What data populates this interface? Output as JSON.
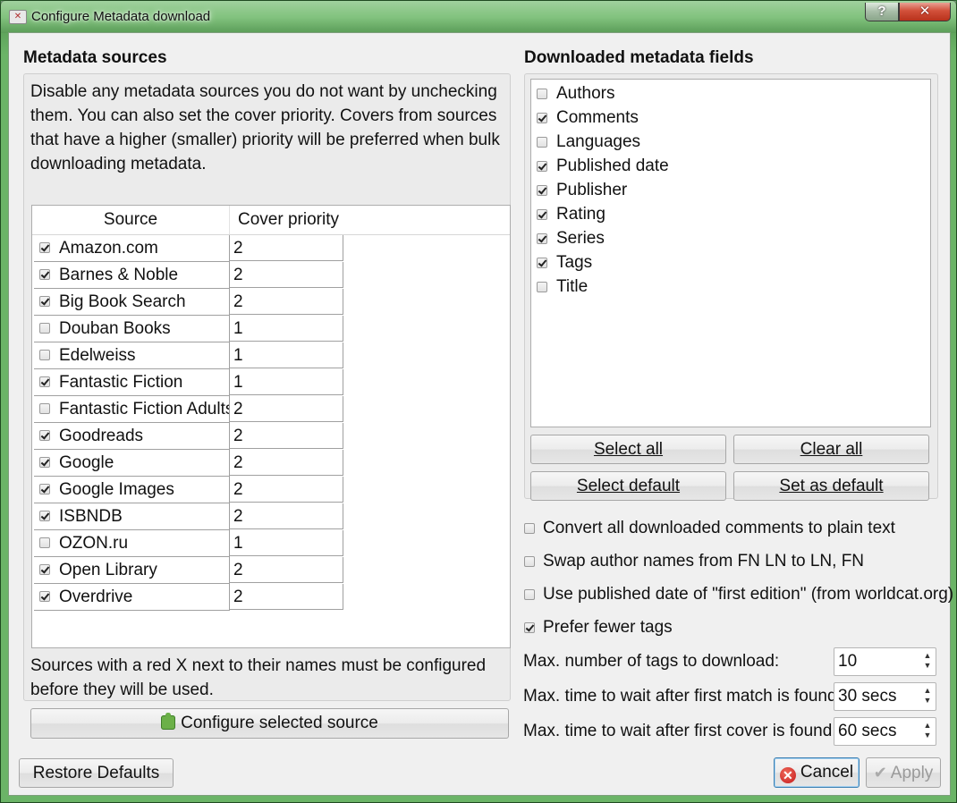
{
  "window": {
    "title": "Configure Metadata download",
    "help_glyph": "?",
    "close_glyph": "✕"
  },
  "sources": {
    "heading": "Metadata sources",
    "description": "Disable any metadata sources you do not want by unchecking them. You can also set the cover priority. Covers from sources that have a higher (smaller) priority will be preferred when bulk downloading metadata.",
    "columns": {
      "source": "Source",
      "priority": "Cover priority"
    },
    "rows": [
      {
        "name": "Amazon.com",
        "priority": "2",
        "checked": true
      },
      {
        "name": "Barnes & Noble",
        "priority": "2",
        "checked": true
      },
      {
        "name": "Big Book Search",
        "priority": "2",
        "checked": true
      },
      {
        "name": "Douban Books",
        "priority": "1",
        "checked": false
      },
      {
        "name": "Edelweiss",
        "priority": "1",
        "checked": false
      },
      {
        "name": "Fantastic Fiction",
        "priority": "1",
        "checked": true
      },
      {
        "name": "Fantastic Fiction Adults",
        "priority": "2",
        "checked": false
      },
      {
        "name": "Goodreads",
        "priority": "2",
        "checked": true
      },
      {
        "name": "Google",
        "priority": "2",
        "checked": true
      },
      {
        "name": "Google Images",
        "priority": "2",
        "checked": true
      },
      {
        "name": "ISBNDB",
        "priority": "2",
        "checked": true
      },
      {
        "name": "OZON.ru",
        "priority": "1",
        "checked": false
      },
      {
        "name": "Open Library",
        "priority": "2",
        "checked": true
      },
      {
        "name": "Overdrive",
        "priority": "2",
        "checked": true
      }
    ],
    "footnote": "Sources with a red X next to their names must be configured before they will be used.",
    "configure_button": "Configure selected source"
  },
  "fields": {
    "heading": "Downloaded metadata fields",
    "items": [
      {
        "label": "Authors",
        "checked": false
      },
      {
        "label": "Comments",
        "checked": true
      },
      {
        "label": "Languages",
        "checked": false
      },
      {
        "label": "Published date",
        "checked": true
      },
      {
        "label": "Publisher",
        "checked": true
      },
      {
        "label": "Rating",
        "checked": true
      },
      {
        "label": "Series",
        "checked": true
      },
      {
        "label": "Tags",
        "checked": true
      },
      {
        "label": "Title",
        "checked": false
      }
    ],
    "select_all_button": "Select all",
    "clear_all_button": "Clear all",
    "select_default_button": "Select default",
    "set_as_default_button": "Set as default"
  },
  "options": {
    "convert_comments": {
      "label": "Convert all downloaded comments to plain text",
      "checked": false
    },
    "swap_author": {
      "label": "Swap author names from FN LN to LN, FN",
      "checked": false
    },
    "published_first_edition": {
      "label": "Use published date of \"first edition\" (from worldcat.org)",
      "checked": false
    },
    "prefer_fewer_tags": {
      "label": "Prefer fewer tags",
      "checked": true
    },
    "max_tags": {
      "label": "Max. number of tags to download:",
      "value": "10"
    },
    "wait_match": {
      "label": "Max. time to wait after first match is found:",
      "value": "30 secs"
    },
    "wait_cover": {
      "label": "Max. time to wait after first cover is found:",
      "value": "60 secs"
    }
  },
  "footer": {
    "restore_defaults": "Restore Defaults",
    "cancel": "Cancel",
    "apply": "Apply"
  }
}
